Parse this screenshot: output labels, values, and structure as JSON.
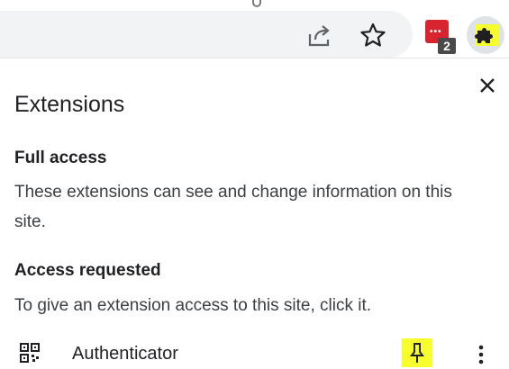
{
  "toolbar": {
    "share_icon": "share-icon",
    "bookmark_icon": "star-icon",
    "extension_badge": "2",
    "extensions_icon": "puzzle-icon",
    "highlight_color": "#f6ff2b"
  },
  "panel": {
    "title": "Extensions",
    "close_icon": "close-icon",
    "full_access": {
      "heading": "Full access",
      "text": "These extensions can see and change information on this site."
    },
    "access_requested": {
      "heading": "Access requested",
      "text": "To give an extension access to this site, click it."
    },
    "extensions": [
      {
        "name": "Authenticator",
        "icon": "qr-code-icon",
        "pin_icon": "pin-icon",
        "menu_icon": "more-vert-icon"
      }
    ]
  }
}
